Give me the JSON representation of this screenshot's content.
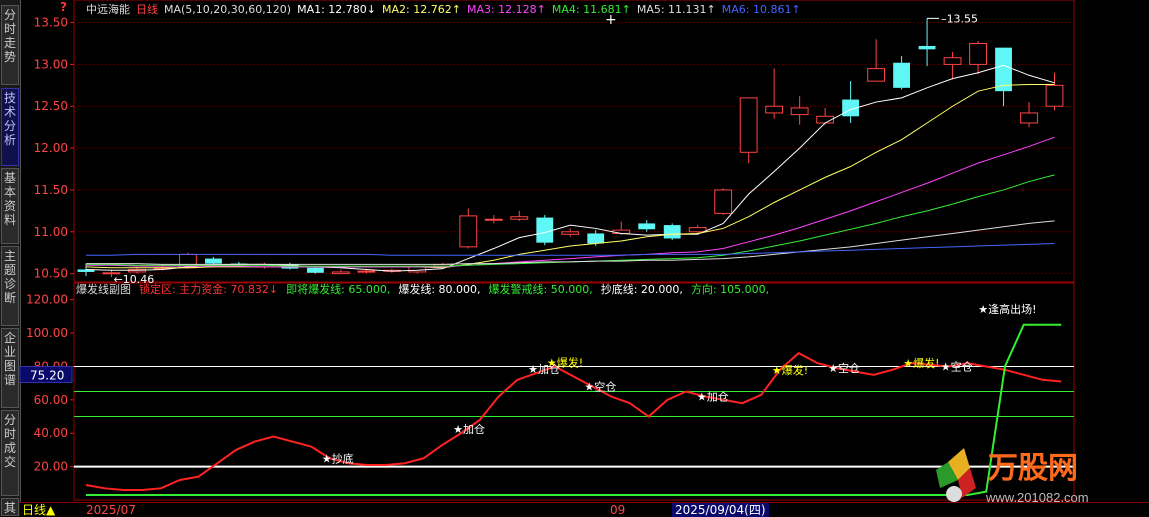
{
  "tabs": [
    {
      "label": "分时走势",
      "active": false
    },
    {
      "label": "技术分析",
      "active": true
    },
    {
      "label": "基本资料",
      "active": false
    },
    {
      "label": "主题诊断",
      "active": false
    },
    {
      "label": "企业图谱",
      "active": false
    },
    {
      "label": "分时成交",
      "active": false
    },
    {
      "label": "其",
      "active": false
    }
  ],
  "top_panel": {
    "stock_name": "中远海能",
    "period": "日线",
    "ma_params": "MA(5,10,20,30,60,120)",
    "ma_values": [
      {
        "label": "MA1: 12.780↓",
        "color": "#ffffff"
      },
      {
        "label": "MA2: 12.762↑",
        "color": "#ffff66"
      },
      {
        "label": "MA3: 12.128↑",
        "color": "#ff44ff"
      },
      {
        "label": "MA4: 11.681↑",
        "color": "#33ee33"
      },
      {
        "label": "MA5: 11.131↑",
        "color": "#dddddd"
      },
      {
        "label": "MA6: 10.861↑",
        "color": "#4466ff"
      }
    ],
    "help_icon": "?",
    "high_marker": "13.55",
    "low_marker": "10.46",
    "ylabels": [
      "13.50",
      "13.00",
      "12.50",
      "12.00",
      "11.50",
      "11.00",
      "10.50"
    ]
  },
  "bottom_panel": {
    "title": "爆发线副图",
    "indicators": [
      {
        "label": "锁定区: 主力资金: 70.832↓",
        "color": "#ff3333"
      },
      {
        "label": "即将爆发线: 65.000,",
        "color": "#33ee33"
      },
      {
        "label": "爆发线: 80.000,",
        "color": "#ffffff"
      },
      {
        "label": "爆发警戒线: 50.000,",
        "color": "#33ee33"
      },
      {
        "label": "抄底线: 20.000,",
        "color": "#ffffff"
      },
      {
        "label": "方向: 105.000,",
        "color": "#33ee33"
      }
    ],
    "ylabels": [
      "120.00",
      "100.00",
      "80.00",
      "60.00",
      "40.00",
      "20.00"
    ],
    "cursor_value": "75.20",
    "annotations": [
      {
        "text": "★抄底",
        "color": "#ffffff"
      },
      {
        "text": "★加仓",
        "color": "#ffffff"
      },
      {
        "text": "★加仓",
        "color": "#ffffff"
      },
      {
        "text": "★爆发!",
        "color": "#ffff00"
      },
      {
        "text": "★空仓",
        "color": "#ffffff"
      },
      {
        "text": "★加仓",
        "color": "#ffffff"
      },
      {
        "text": "★爆发!",
        "color": "#ffff00"
      },
      {
        "text": "★空仓",
        "color": "#ffffff"
      },
      {
        "text": "★爆发!",
        "color": "#ffff00"
      },
      {
        "text": "★空仓",
        "color": "#ffffff"
      },
      {
        "text": "★逢高出场!",
        "color": "#ffffff"
      }
    ]
  },
  "bottom_bar": {
    "period_label": "日线▲",
    "date_start": "2025/07",
    "month_marker": "09",
    "cursor_date": "2025/09/04(四)"
  },
  "watermark": {
    "text": "万股网",
    "url": "www.201082.com"
  },
  "chart_data": {
    "type": "candlestick",
    "price_candles": [
      [
        10.55,
        10.52,
        10.62,
        10.47
      ],
      [
        10.5,
        10.51,
        10.55,
        10.46
      ],
      [
        10.52,
        10.55,
        10.58,
        10.5
      ],
      [
        10.56,
        10.57,
        10.6,
        10.54
      ],
      [
        10.57,
        10.73,
        10.75,
        10.56
      ],
      [
        10.68,
        10.62,
        10.7,
        10.6
      ],
      [
        10.62,
        10.6,
        10.64,
        10.58
      ],
      [
        10.58,
        10.61,
        10.63,
        10.56
      ],
      [
        10.61,
        10.56,
        10.63,
        10.55
      ],
      [
        10.57,
        10.51,
        10.58,
        10.5
      ],
      [
        10.5,
        10.52,
        10.55,
        10.49
      ],
      [
        10.52,
        10.53,
        10.56,
        10.5
      ],
      [
        10.53,
        10.54,
        10.56,
        10.51
      ],
      [
        10.52,
        10.59,
        10.6,
        10.5
      ],
      [
        10.59,
        10.61,
        10.63,
        10.57
      ],
      [
        10.82,
        11.19,
        11.28,
        10.8
      ],
      [
        11.14,
        11.15,
        11.2,
        11.1
      ],
      [
        11.15,
        11.18,
        11.25,
        11.13
      ],
      [
        11.17,
        10.87,
        11.2,
        10.84
      ],
      [
        10.97,
        11.0,
        11.04,
        10.94
      ],
      [
        10.98,
        10.86,
        11.02,
        10.83
      ],
      [
        10.98,
        11.02,
        11.12,
        10.96
      ],
      [
        11.1,
        11.03,
        11.14,
        11.0
      ],
      [
        11.08,
        10.92,
        11.1,
        10.9
      ],
      [
        11.0,
        11.05,
        11.08,
        10.98
      ],
      [
        11.22,
        11.5,
        11.52,
        11.2
      ],
      [
        11.95,
        12.6,
        12.6,
        11.82
      ],
      [
        12.42,
        12.5,
        12.95,
        12.35
      ],
      [
        12.4,
        12.48,
        12.62,
        12.28
      ],
      [
        12.3,
        12.38,
        12.48,
        12.28
      ],
      [
        12.58,
        12.38,
        12.8,
        12.3
      ],
      [
        12.8,
        12.95,
        13.3,
        12.8
      ],
      [
        13.02,
        12.72,
        13.1,
        12.7
      ],
      [
        13.22,
        13.18,
        13.55,
        12.98
      ],
      [
        13.0,
        13.08,
        13.15,
        12.82
      ],
      [
        13.0,
        13.25,
        13.28,
        12.88
      ],
      [
        13.2,
        12.68,
        13.2,
        12.5
      ],
      [
        12.3,
        12.42,
        12.55,
        12.25
      ],
      [
        12.5,
        12.75,
        12.9,
        12.45
      ]
    ],
    "ma_series": [
      {
        "name": "MA1",
        "values": [
          10.55,
          10.54,
          10.54,
          10.55,
          10.58,
          10.6,
          10.61,
          10.61,
          10.6,
          10.58,
          10.57,
          10.55,
          10.53,
          10.54,
          10.56,
          10.68,
          10.8,
          10.93,
          10.99,
          11.08,
          11.04,
          10.98,
          10.96,
          10.97,
          10.97,
          11.1,
          11.45,
          11.72,
          12.0,
          12.3,
          12.46,
          12.55,
          12.6,
          12.72,
          12.83,
          12.9,
          12.99,
          12.87,
          12.78
        ]
      },
      {
        "name": "MA2",
        "values": [
          10.58,
          10.57,
          10.57,
          10.57,
          10.57,
          10.58,
          10.58,
          10.58,
          10.58,
          10.58,
          10.58,
          10.58,
          10.58,
          10.58,
          10.57,
          10.61,
          10.66,
          10.73,
          10.78,
          10.83,
          10.86,
          10.89,
          10.94,
          10.97,
          10.98,
          11.04,
          11.18,
          11.35,
          11.5,
          11.65,
          11.78,
          11.95,
          12.1,
          12.3,
          12.5,
          12.68,
          12.75,
          12.76,
          12.76
        ]
      },
      {
        "name": "MA3",
        "values": [
          10.6,
          10.6,
          10.59,
          10.59,
          10.59,
          10.59,
          10.59,
          10.58,
          10.58,
          10.58,
          10.58,
          10.58,
          10.58,
          10.58,
          10.58,
          10.6,
          10.62,
          10.64,
          10.66,
          10.68,
          10.7,
          10.72,
          10.73,
          10.75,
          10.76,
          10.8,
          10.88,
          10.96,
          11.05,
          11.15,
          11.25,
          11.36,
          11.47,
          11.58,
          11.7,
          11.82,
          11.92,
          12.02,
          12.13
        ]
      },
      {
        "name": "MA4",
        "values": [
          10.61,
          10.61,
          10.6,
          10.6,
          10.6,
          10.6,
          10.6,
          10.6,
          10.59,
          10.59,
          10.59,
          10.59,
          10.59,
          10.59,
          10.59,
          10.6,
          10.61,
          10.62,
          10.63,
          10.64,
          10.65,
          10.66,
          10.67,
          10.68,
          10.69,
          10.72,
          10.77,
          10.83,
          10.89,
          10.96,
          11.03,
          11.1,
          11.18,
          11.25,
          11.33,
          11.42,
          11.5,
          11.6,
          11.68
        ]
      },
      {
        "name": "MA5",
        "values": [
          10.62,
          10.62,
          10.62,
          10.61,
          10.61,
          10.61,
          10.61,
          10.61,
          10.61,
          10.61,
          10.61,
          10.61,
          10.61,
          10.61,
          10.61,
          10.62,
          10.62,
          10.63,
          10.64,
          10.64,
          10.65,
          10.65,
          10.66,
          10.66,
          10.67,
          10.68,
          10.7,
          10.73,
          10.76,
          10.79,
          10.82,
          10.86,
          10.9,
          10.94,
          10.98,
          11.02,
          11.06,
          11.1,
          11.13
        ]
      },
      {
        "name": "MA6",
        "values": [
          10.72,
          10.72,
          10.73,
          10.73,
          10.73,
          10.73,
          10.73,
          10.73,
          10.73,
          10.73,
          10.73,
          10.73,
          10.72,
          10.72,
          10.72,
          10.72,
          10.72,
          10.72,
          10.72,
          10.72,
          10.72,
          10.72,
          10.73,
          10.73,
          10.73,
          10.73,
          10.74,
          10.75,
          10.76,
          10.77,
          10.78,
          10.79,
          10.8,
          10.81,
          10.82,
          10.83,
          10.84,
          10.85,
          10.86
        ]
      }
    ],
    "indicator": {
      "main_force": [
        9,
        7,
        6,
        6,
        7,
        12,
        14,
        22,
        30,
        35,
        38,
        35,
        32,
        25,
        22,
        21,
        21,
        22,
        25,
        33,
        40,
        48,
        62,
        72,
        76,
        80,
        74,
        68,
        62,
        58,
        50,
        60,
        65,
        62,
        60,
        58,
        63,
        78,
        88,
        82,
        79,
        77,
        75,
        78,
        82,
        81,
        80,
        82,
        80,
        78,
        75,
        72,
        71
      ],
      "entry_line": [
        3,
        3,
        3,
        3,
        3,
        3,
        3,
        3,
        3,
        3,
        3,
        3,
        3,
        3,
        3,
        3,
        3,
        3,
        3,
        3,
        3,
        3,
        3,
        3,
        3,
        3,
        3,
        3,
        3,
        3,
        3,
        3,
        3,
        3,
        3,
        3,
        3,
        3,
        3,
        3,
        3,
        3,
        3,
        3,
        3,
        3,
        3,
        3,
        5,
        80,
        105,
        105,
        105
      ]
    },
    "levels": [
      80,
      65,
      50,
      20
    ],
    "ylim_price": [
      10.4,
      13.65
    ],
    "ylim_indicator": [
      0,
      130
    ]
  }
}
